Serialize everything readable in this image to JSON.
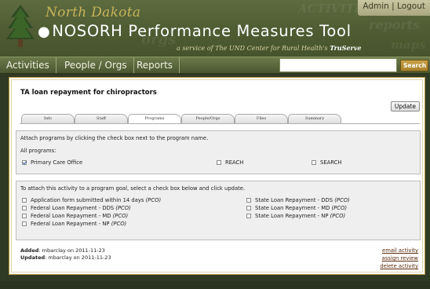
{
  "header": {
    "state_title": "North Dakota",
    "app_title": "NOSORH Performance Measures Tool",
    "subtitle_prefix": "a service of  The UND Center for Rural Health's",
    "subtitle_brand": "TruServe",
    "admin_link": "Admin",
    "separator": "|",
    "logout_link": "Logout",
    "bg_watermarks": [
      "ACTIVITIES",
      "orgs",
      "maps",
      "reports"
    ]
  },
  "nav": {
    "items": [
      "Activities",
      "People / Orgs",
      "Reports"
    ],
    "search_value": "",
    "search_button": "Search"
  },
  "page": {
    "title": "TA loan repayment for chiropractors",
    "update_button": "Update",
    "tabs": [
      "Info",
      "Staff",
      "Programs",
      "People/Orgs",
      "Files",
      "Summary"
    ],
    "active_tab": "Programs"
  },
  "programs_panel": {
    "instruction": "Attach programs by clicking the check box next to the program name.",
    "all_programs_label": "All programs:",
    "programs": [
      {
        "label": "Primary Care Office",
        "checked": true
      },
      {
        "label": "REACH",
        "checked": false
      },
      {
        "label": "SEARCH",
        "checked": false
      }
    ]
  },
  "goals_panel": {
    "instruction": "To attach this activity to a program goal, select a check box below and click update.",
    "left_goals": [
      {
        "label": "Application form submitted within 14 days",
        "tag": "(PCO)"
      },
      {
        "label": "Federal Loan Repayment - DDS",
        "tag": "(PCO)"
      },
      {
        "label": "Federal Loan Repayment - MD",
        "tag": "(PCO)"
      },
      {
        "label": "Federal Loan Repayment - NP",
        "tag": "(PCO)"
      }
    ],
    "right_goals": [
      {
        "label": "State Loan Repayment - DDS",
        "tag": "(PCO)"
      },
      {
        "label": "State Loan Repayment - MD",
        "tag": "(PCO)"
      },
      {
        "label": "State Loan Repayment - NP",
        "tag": "(PCO)"
      }
    ]
  },
  "meta": {
    "added_label": "Added",
    "added_value": ": mbarclay on 2011-11-23",
    "updated_label": "Updated",
    "updated_value": ": mbarclay on 2011-11-23"
  },
  "actions": {
    "email": "email activity",
    "assign": "assign review",
    "delete": "delete activity"
  },
  "colors": {
    "header_bg": "#4f5c33",
    "title_gold": "#c6b45a",
    "content_border": "#b8953a",
    "link": "#5a2a0a"
  }
}
